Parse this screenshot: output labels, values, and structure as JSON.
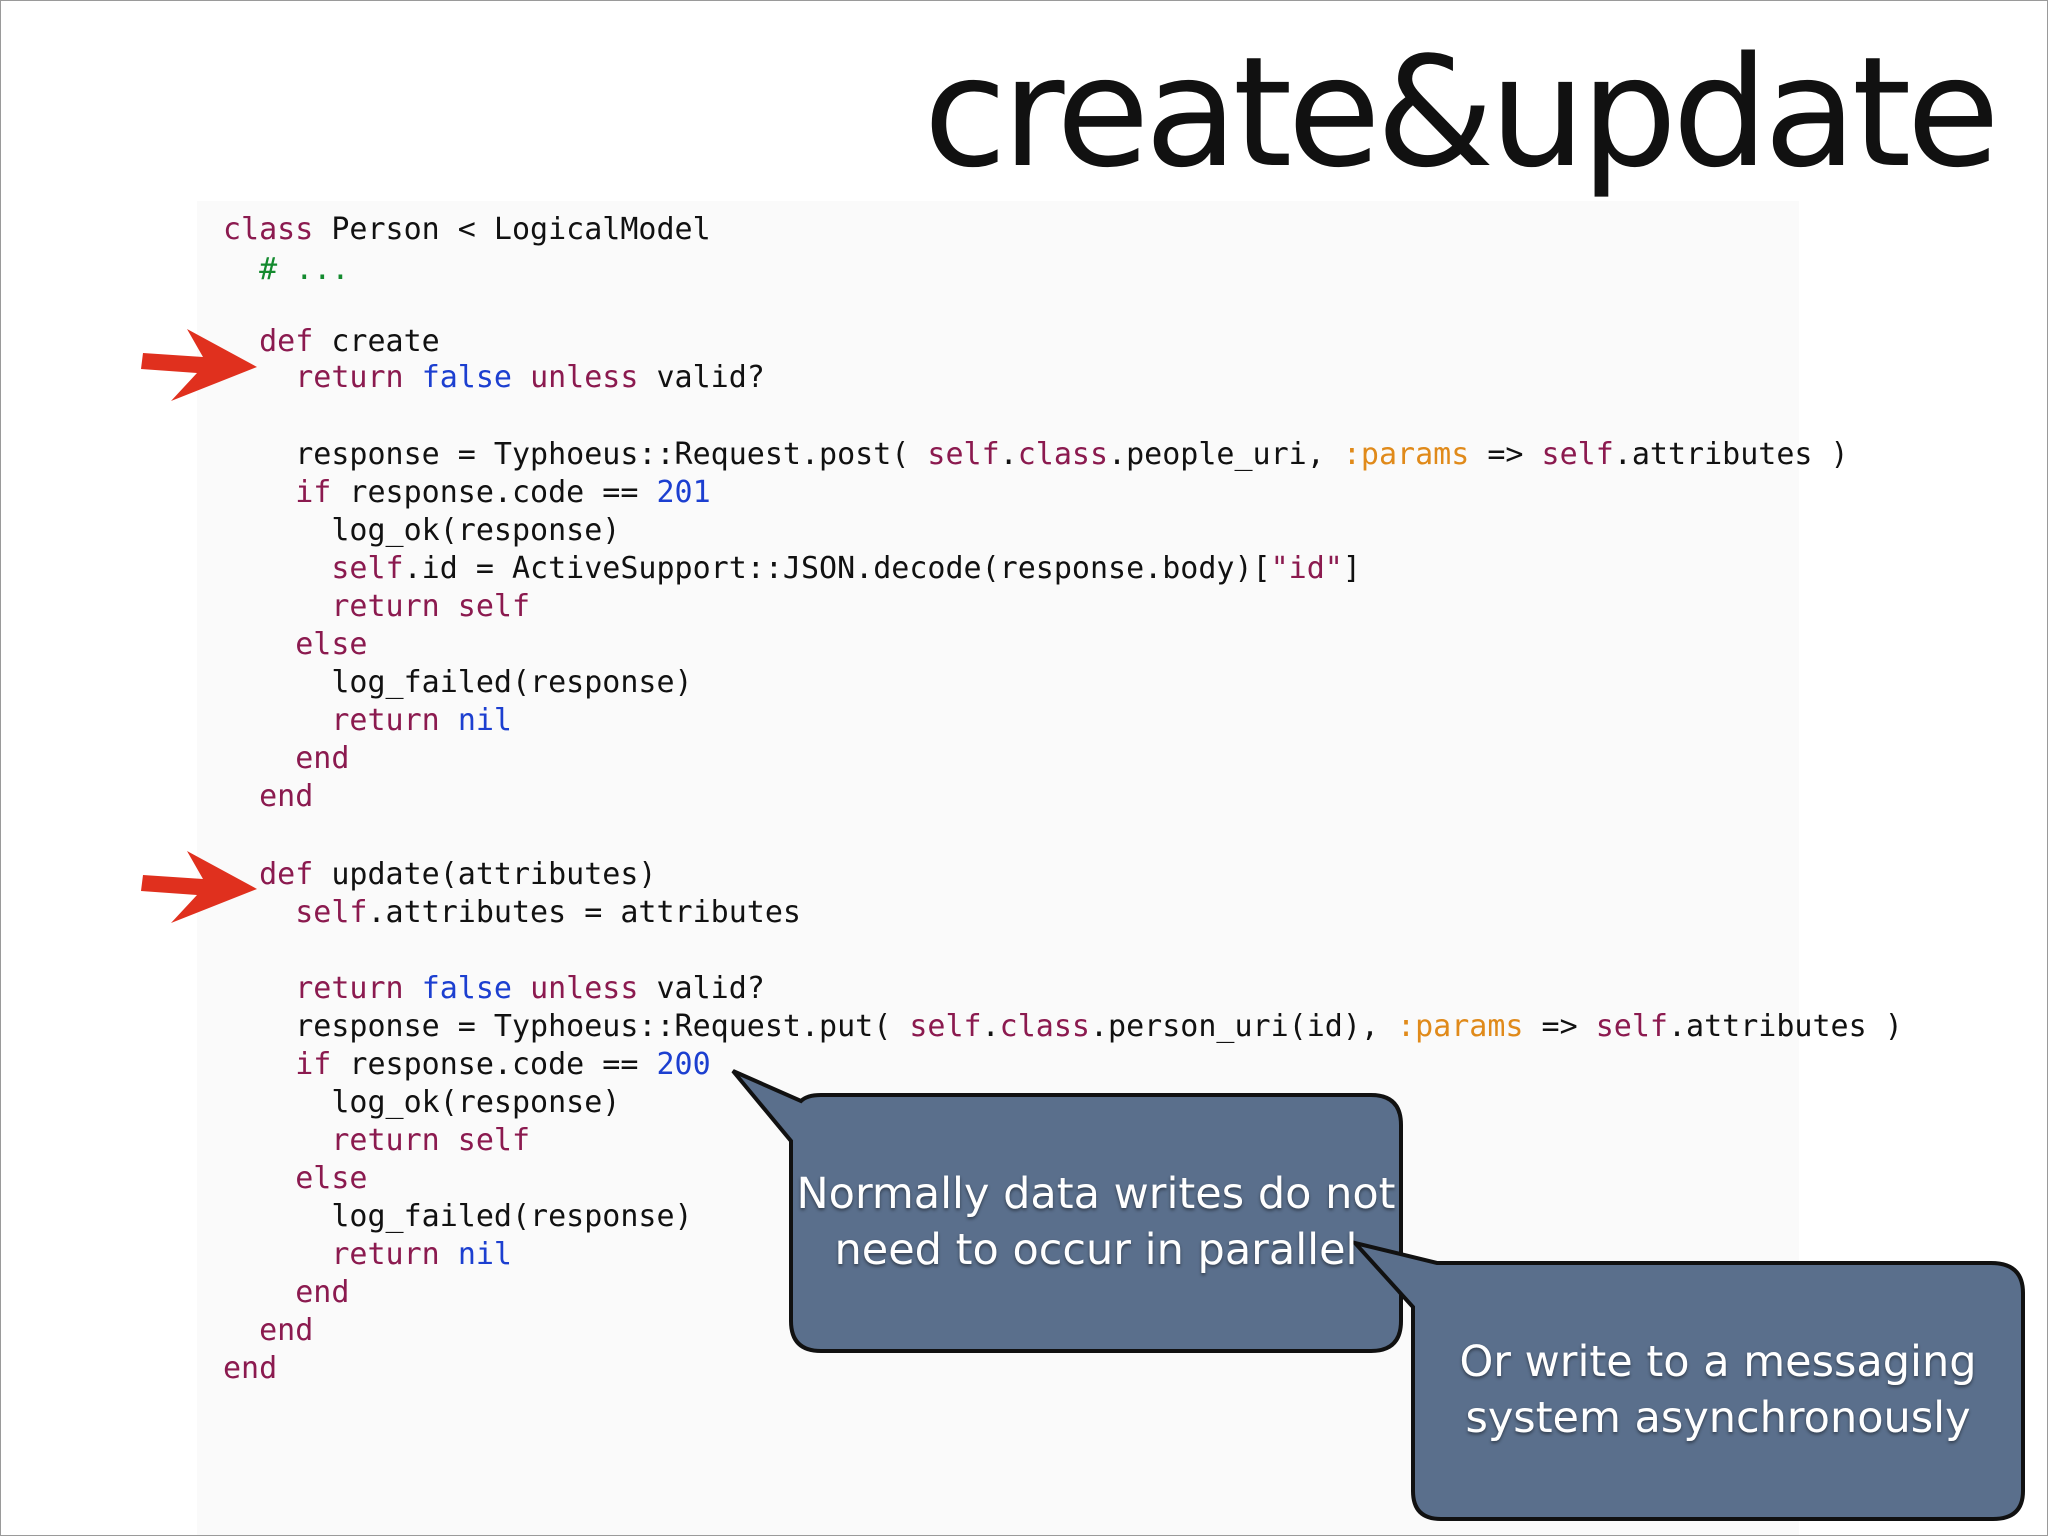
{
  "slide": {
    "title": "create&update"
  },
  "code": {
    "lines": [
      [
        [
          "k",
          "class"
        ],
        [
          "t",
          " Person < LogicalModel"
        ]
      ],
      [
        [
          "c",
          "  # ..."
        ]
      ],
      [],
      [
        [
          "k",
          "  def"
        ],
        [
          "t",
          " create"
        ]
      ],
      [
        [
          "k",
          "    return"
        ],
        [
          "t",
          " "
        ],
        [
          "b",
          "false"
        ],
        [
          "t",
          " "
        ],
        [
          "k",
          "unless"
        ],
        [
          "t",
          " valid?"
        ]
      ],
      [],
      [
        [
          "t",
          "    response = Typhoeus::Request.post( "
        ],
        [
          "k",
          "self"
        ],
        [
          "t",
          "."
        ],
        [
          "k",
          "class"
        ],
        [
          "t",
          ".people_uri, "
        ],
        [
          "s",
          ":params"
        ],
        [
          "t",
          " => "
        ],
        [
          "k",
          "self"
        ],
        [
          "t",
          ".attributes )"
        ]
      ],
      [
        [
          "k",
          "    if"
        ],
        [
          "t",
          " response.code == "
        ],
        [
          "b",
          "201"
        ]
      ],
      [
        [
          "t",
          "      log_ok(response)"
        ]
      ],
      [
        [
          "k",
          "      self"
        ],
        [
          "t",
          ".id = ActiveSupport::JSON.decode(response.body)["
        ],
        [
          "k",
          "\"id\""
        ],
        [
          "t",
          "]"
        ]
      ],
      [
        [
          "k",
          "      return self"
        ]
      ],
      [
        [
          "k",
          "    else"
        ]
      ],
      [
        [
          "t",
          "      log_failed(response)"
        ]
      ],
      [
        [
          "k",
          "      return"
        ],
        [
          "t",
          " "
        ],
        [
          "b",
          "nil"
        ]
      ],
      [
        [
          "k",
          "    end"
        ]
      ],
      [
        [
          "k",
          "  end"
        ]
      ],
      [],
      [
        [
          "k",
          "  def"
        ],
        [
          "t",
          " update(attributes)"
        ]
      ],
      [
        [
          "k",
          "    self"
        ],
        [
          "t",
          ".attributes = attributes"
        ]
      ],
      [],
      [
        [
          "k",
          "    return"
        ],
        [
          "t",
          " "
        ],
        [
          "b",
          "false"
        ],
        [
          "t",
          " "
        ],
        [
          "k",
          "unless"
        ],
        [
          "t",
          " valid?"
        ]
      ],
      [
        [
          "t",
          "    response = Typhoeus::Request.put( "
        ],
        [
          "k",
          "self"
        ],
        [
          "t",
          "."
        ],
        [
          "k",
          "class"
        ],
        [
          "t",
          ".person_uri(id), "
        ],
        [
          "s",
          ":params"
        ],
        [
          "t",
          " => "
        ],
        [
          "k",
          "self"
        ],
        [
          "t",
          ".attributes )"
        ]
      ],
      [
        [
          "k",
          "    if"
        ],
        [
          "t",
          " response.code == "
        ],
        [
          "b",
          "200"
        ]
      ],
      [
        [
          "t",
          "      log_ok(response)"
        ]
      ],
      [
        [
          "k",
          "      return self"
        ]
      ],
      [
        [
          "k",
          "    else"
        ]
      ],
      [
        [
          "t",
          "      log_failed(response)"
        ]
      ],
      [
        [
          "k",
          "      return"
        ],
        [
          "t",
          " "
        ],
        [
          "b",
          "nil"
        ]
      ],
      [
        [
          "k",
          "    end"
        ]
      ],
      [
        [
          "k",
          "  end"
        ]
      ],
      [
        [
          "k",
          "end"
        ]
      ]
    ]
  },
  "callouts": {
    "first": {
      "text": "Normally data writes do not\nneed to occur in parallel"
    },
    "second": {
      "text": "Or write to a messaging\nsystem asynchronously"
    }
  },
  "colors": {
    "keyword": "#8b1a4f",
    "comment": "#138a2e",
    "literal": "#1c3fd0",
    "symbol": "#e08a1a",
    "arrow": "#e0301e",
    "bubble_fill": "#5a6f8c",
    "bubble_border": "#111111"
  },
  "icons": {
    "arrows": [
      "right-arrow-icon",
      "right-arrow-icon"
    ]
  }
}
